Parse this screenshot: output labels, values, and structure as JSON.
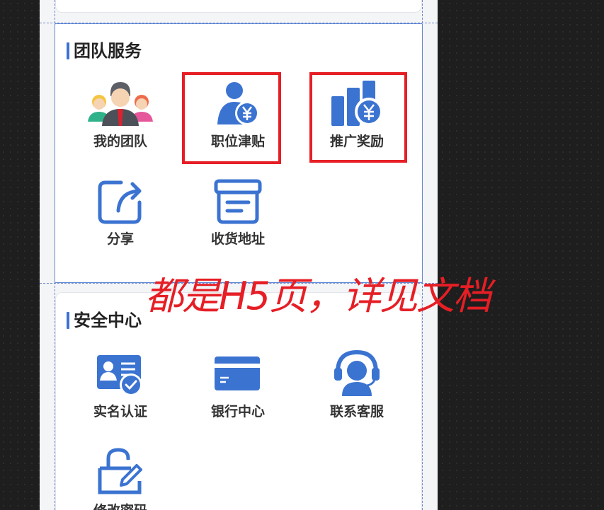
{
  "colors": {
    "accent": "#3b73d1",
    "highlight": "#e61e25"
  },
  "team_section": {
    "title": "团队服务",
    "items": [
      {
        "label": "我的团队",
        "icon": "team-people-icon"
      },
      {
        "label": "职位津贴",
        "icon": "user-yen-icon"
      },
      {
        "label": "推广奖励",
        "icon": "bar-chart-yen-icon"
      },
      {
        "label": "分享",
        "icon": "share-icon"
      },
      {
        "label": "收货地址",
        "icon": "address-box-icon"
      }
    ]
  },
  "security_section": {
    "title": "安全中心",
    "items": [
      {
        "label": "实名认证",
        "icon": "id-card-verified-icon"
      },
      {
        "label": "银行中心",
        "icon": "bank-card-icon"
      },
      {
        "label": "联系客服",
        "icon": "headset-support-icon"
      },
      {
        "label": "修改密码",
        "icon": "unlock-edit-icon"
      }
    ]
  },
  "annotation": {
    "text": "都是H5页，详见文档"
  }
}
